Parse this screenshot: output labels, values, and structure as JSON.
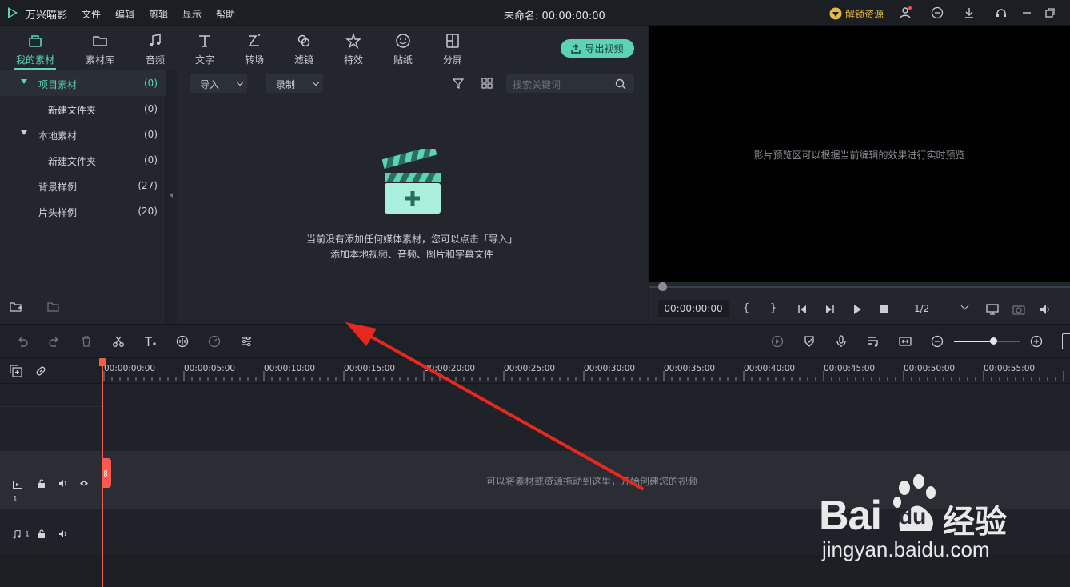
{
  "app": {
    "name": "万兴喵影",
    "doc_title": "未命名: 00:00:00:00",
    "unlock_label": "解锁资源"
  },
  "menu": [
    "文件",
    "编辑",
    "剪辑",
    "显示",
    "帮助"
  ],
  "tabs": [
    {
      "label": "我的素材",
      "icon": "my-media-icon",
      "active": true
    },
    {
      "label": "素材库",
      "icon": "library-icon"
    },
    {
      "label": "音频",
      "icon": "music-note-icon"
    },
    {
      "label": "文字",
      "icon": "text-icon"
    },
    {
      "label": "转场",
      "icon": "transition-icon"
    },
    {
      "label": "滤镜",
      "icon": "filter-icon"
    },
    {
      "label": "特效",
      "icon": "effects-icon"
    },
    {
      "label": "贴纸",
      "icon": "sticker-icon"
    },
    {
      "label": "分屏",
      "icon": "split-screen-icon"
    }
  ],
  "export_label": "导出视频",
  "tree": [
    {
      "label": "项目素材",
      "count": "(0)"
    },
    {
      "label": "新建文件夹",
      "count": "(0)"
    },
    {
      "label": "本地素材",
      "count": "(0)"
    },
    {
      "label": "新建文件夹",
      "count": "(0)"
    },
    {
      "label": "背景样例",
      "count": "(27)"
    },
    {
      "label": "片头样例",
      "count": "(20)"
    }
  ],
  "media_toolbar": {
    "import_label": "导入",
    "record_label": "录制",
    "search_placeholder": "搜索关键词"
  },
  "empty_state": {
    "line1": "当前没有添加任何媒体素材，您可以点击「导入」",
    "line2": "添加本地视频、音频、图片和字幕文件"
  },
  "preview": {
    "hint": "影片预览区可以根据当前编辑的效果进行实时预览",
    "timecode": "00:00:00:00",
    "ratio": "1/2"
  },
  "ruler_ticks": [
    "00:00:00:00",
    "00:00:05:00",
    "00:00:10:00",
    "00:00:15:00",
    "00:00:20:00",
    "00:00:25:00",
    "00:00:30:00",
    "00:00:35:00",
    "00:00:40:00",
    "00:00:45:00",
    "00:00:50:00",
    "00:00:55:00"
  ],
  "timeline": {
    "video_hint": "可以将素材或资源拖动到这里，开始创建您的视频",
    "video_track_no": "1",
    "audio_track_no": "1"
  },
  "watermark": {
    "brand": "Bai",
    "brand2": "du",
    "cn": "经验",
    "url": "jingyan.baidu.com"
  },
  "colors": {
    "accent": "#5cd3b4",
    "playhead": "#ff5a4d",
    "unlock": "#e8b64c",
    "arrow": "#e8281e"
  }
}
